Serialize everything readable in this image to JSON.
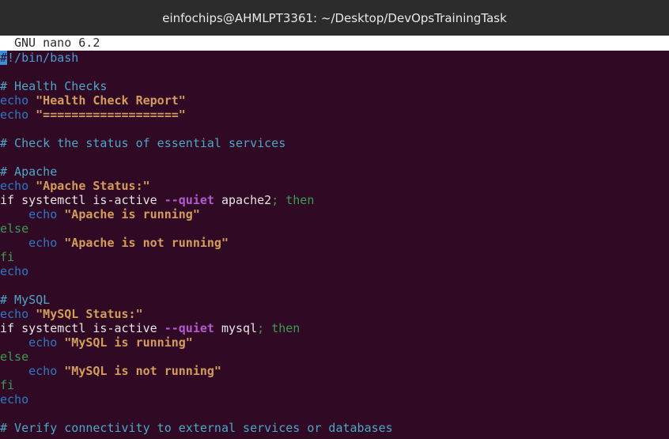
{
  "window": {
    "title": "einfochips@AHMLPT3361: ~/Desktop/DevOpsTrainingTask"
  },
  "nano": {
    "version_label": "GNU nano 6.2"
  },
  "code": {
    "shebang_hash": "#",
    "shebang_rest": "!/bin/bash",
    "comment_health_checks": "# Health Checks",
    "echo_kw": "echo",
    "str_health_report": "\"Health Check Report\"",
    "str_separator": "\"===================\"",
    "comment_check_status": "# Check the status of essential services",
    "comment_apache": "# Apache",
    "str_apache_status": "\"Apache Status:\"",
    "if_kw": "if",
    "systemctl_cmd": "systemctl is-active",
    "quiet_flag": "--quiet",
    "apache_service": "apache2",
    "semicolon": ";",
    "then_kw": "then",
    "indent_echo": "    echo",
    "str_apache_running": "\"Apache is running\"",
    "else_kw": "else",
    "str_apache_not_running": "\"Apache is not running\"",
    "fi_kw": "fi",
    "comment_mysql": "# MySQL",
    "str_mysql_status": "\"MySQL Status:\"",
    "mysql_service": "mysql",
    "str_mysql_running": "\"MySQL is running\"",
    "str_mysql_not_running": "\"MySQL is not running\"",
    "comment_verify": "# Verify connectivity to external services or databases"
  },
  "colors": {
    "terminal_bg": "#300a24",
    "titlebar_bg": "#2c2c2c",
    "comment": "#4ea6c8",
    "keyword_echo": "#2f78c5",
    "string": "#d39d5b",
    "flag": "#b45ad0",
    "then": "#3c9b52"
  }
}
